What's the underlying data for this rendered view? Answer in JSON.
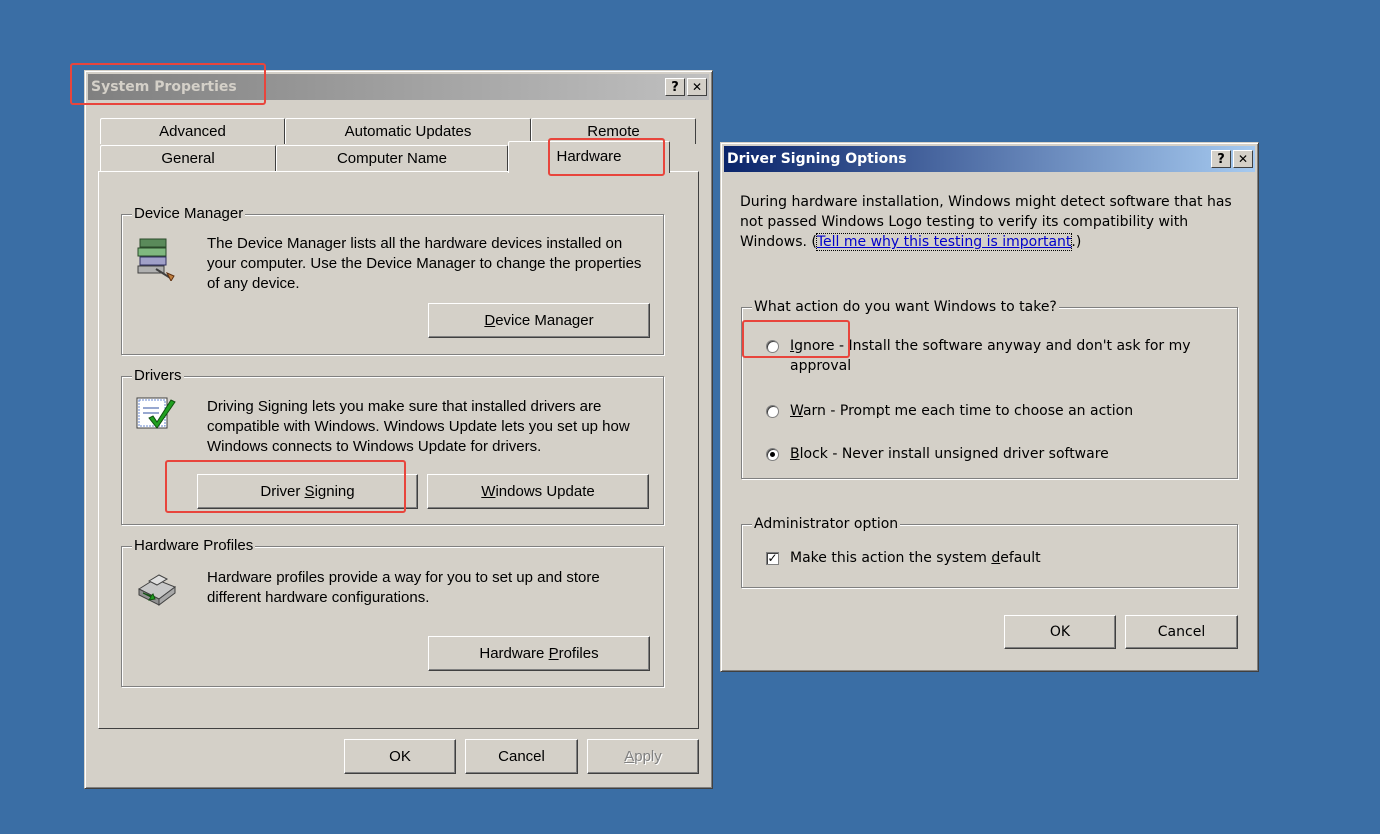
{
  "system_properties": {
    "title": "System Properties",
    "help_btn": "?",
    "close_btn": "✕",
    "tabs_row1": [
      "Advanced",
      "Automatic Updates",
      "Remote"
    ],
    "tabs_row2": [
      "General",
      "Computer Name",
      "Hardware"
    ],
    "active_tab": "Hardware",
    "device_manager": {
      "label": "Device Manager",
      "description": "The Device Manager lists all the hardware devices installed on your computer. Use the Device Manager to change the properties of any device.",
      "button_prefix": "",
      "button_accel": "D",
      "button_rest": "evice Manager"
    },
    "drivers": {
      "label": "Drivers",
      "description": "Driving Signing lets you make sure that installed drivers are compatible with Windows. Windows Update lets you set up how Windows connects to Windows Update for drivers.",
      "signing_prefix": "Driver ",
      "signing_accel": "S",
      "signing_rest": "igning",
      "update_prefix": "",
      "update_accel": "W",
      "update_rest": "indows Update"
    },
    "hardware_profiles": {
      "label": "Hardware Profiles",
      "description": "Hardware profiles provide a way for you to set up and store different hardware configurations.",
      "button_prefix": "Hardware ",
      "button_accel": "P",
      "button_rest": "rofiles"
    },
    "ok": "OK",
    "cancel": "Cancel",
    "apply_accel": "A",
    "apply_rest": "pply"
  },
  "driver_signing": {
    "title": "Driver Signing Options",
    "help_btn": "?",
    "close_btn": "✕",
    "intro": "During hardware installation, Windows might detect software that has not passed Windows Logo testing to verify its compatibility with Windows. (",
    "link": "Tell me why this testing is important",
    "intro_end": ".)",
    "action_group": "What action do you want Windows to take?",
    "options": [
      {
        "accel": "I",
        "rest": "gnore",
        "desc": " - Install the software anyway and don't ask for my approval",
        "selected": false
      },
      {
        "accel": "W",
        "rest": "arn",
        "desc": " - Prompt me each time to choose an action",
        "selected": false
      },
      {
        "accel": "B",
        "rest": "lock",
        "desc": " - Never install unsigned driver software",
        "selected": true
      }
    ],
    "admin_group": "Administrator option",
    "admin_check_prefix": "Make this action the system ",
    "admin_check_accel": "d",
    "admin_check_rest": "efault",
    "admin_checked": true,
    "check_mark": "✓",
    "ok": "OK",
    "cancel": "Cancel"
  },
  "colors": {
    "desktop": "#3a6ea5",
    "highlight": "#e8453c",
    "active_title": "#0a246a",
    "inactive_title": "#808080"
  }
}
